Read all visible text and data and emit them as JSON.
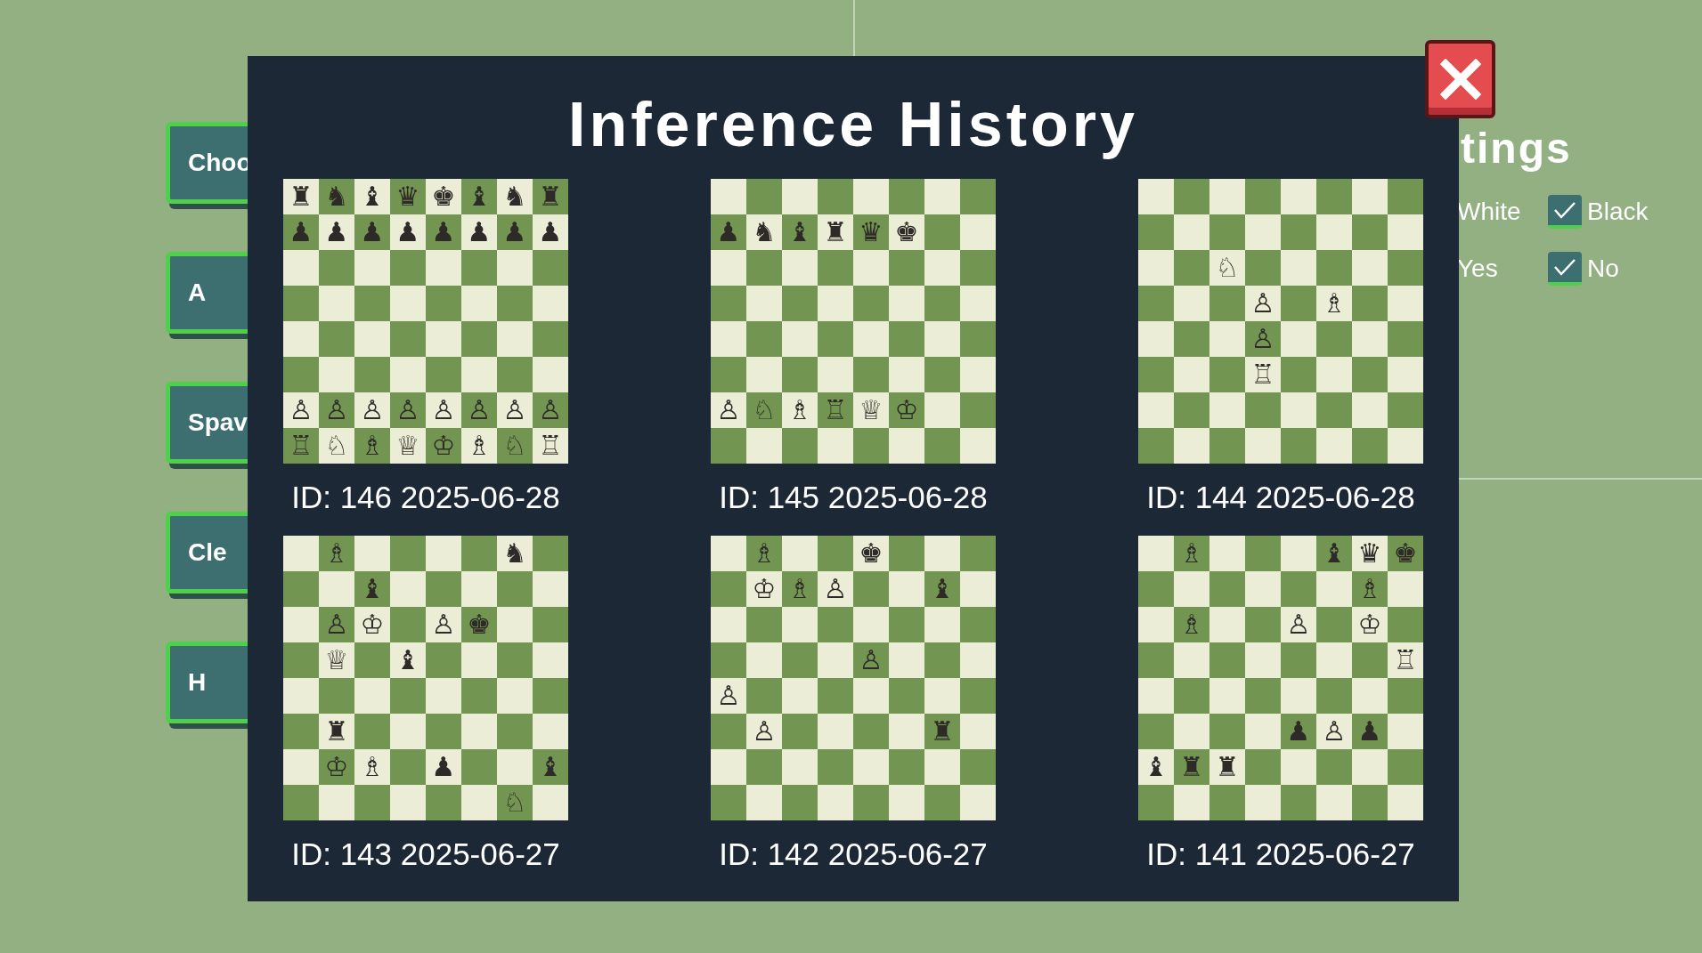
{
  "side_buttons": [
    {
      "label": "Choo"
    },
    {
      "label": "A"
    },
    {
      "label": "Spav"
    },
    {
      "label": "Cle"
    },
    {
      "label": "H"
    }
  ],
  "settings": {
    "title": "tings",
    "rows": [
      [
        {
          "label": "White"
        },
        {
          "label": "Black",
          "checked": true
        }
      ],
      [
        {
          "label": "Yes"
        },
        {
          "label": "No",
          "checked": true
        }
      ]
    ]
  },
  "dialog": {
    "title": "Inference History",
    "close": {
      "kind": "close"
    },
    "entries": [
      {
        "caption": "ID: 146 2025-06-28",
        "rows": [
          [
            {
              "kind": "piece",
              "glyph": "♜"
            },
            {
              "kind": "piece",
              "glyph": "♞"
            },
            {
              "kind": "piece",
              "glyph": "♝"
            },
            {
              "kind": "piece",
              "glyph": "♛"
            },
            {
              "kind": "piece",
              "glyph": "♚"
            },
            {
              "kind": "piece",
              "glyph": "♝"
            },
            {
              "kind": "piece",
              "glyph": "♞"
            },
            {
              "kind": "piece",
              "glyph": "♜"
            }
          ],
          [
            {
              "kind": "piece",
              "glyph": "♟"
            },
            {
              "kind": "piece",
              "glyph": "♟"
            },
            {
              "kind": "piece",
              "glyph": "♟"
            },
            {
              "kind": "piece",
              "glyph": "♟"
            },
            {
              "kind": "piece",
              "glyph": "♟"
            },
            {
              "kind": "piece",
              "glyph": "♟"
            },
            {
              "kind": "piece",
              "glyph": "♟"
            },
            {
              "kind": "piece",
              "glyph": "♟"
            }
          ],
          [
            {
              "kind": "empty"
            },
            {
              "kind": "empty"
            },
            {
              "kind": "empty"
            },
            {
              "kind": "empty"
            },
            {
              "kind": "empty"
            },
            {
              "kind": "empty"
            },
            {
              "kind": "empty"
            },
            {
              "kind": "empty"
            }
          ],
          [
            {
              "kind": "empty"
            },
            {
              "kind": "empty"
            },
            {
              "kind": "empty"
            },
            {
              "kind": "empty"
            },
            {
              "kind": "empty"
            },
            {
              "kind": "empty"
            },
            {
              "kind": "empty"
            },
            {
              "kind": "empty"
            }
          ],
          [
            {
              "kind": "empty"
            },
            {
              "kind": "empty"
            },
            {
              "kind": "empty"
            },
            {
              "kind": "empty"
            },
            {
              "kind": "empty"
            },
            {
              "kind": "empty"
            },
            {
              "kind": "empty"
            },
            {
              "kind": "empty"
            }
          ],
          [
            {
              "kind": "empty"
            },
            {
              "kind": "empty"
            },
            {
              "kind": "empty"
            },
            {
              "kind": "empty"
            },
            {
              "kind": "empty"
            },
            {
              "kind": "empty"
            },
            {
              "kind": "empty"
            },
            {
              "kind": "empty"
            }
          ],
          [
            {
              "kind": "piece",
              "glyph": "♙"
            },
            {
              "kind": "piece",
              "glyph": "♙"
            },
            {
              "kind": "piece",
              "glyph": "♙"
            },
            {
              "kind": "piece",
              "glyph": "♙"
            },
            {
              "kind": "piece",
              "glyph": "♙"
            },
            {
              "kind": "piece",
              "glyph": "♙"
            },
            {
              "kind": "piece",
              "glyph": "♙"
            },
            {
              "kind": "piece",
              "glyph": "♙"
            }
          ],
          [
            {
              "kind": "piece",
              "glyph": "♖"
            },
            {
              "kind": "piece",
              "glyph": "♘"
            },
            {
              "kind": "piece",
              "glyph": "♗"
            },
            {
              "kind": "piece",
              "glyph": "♕"
            },
            {
              "kind": "piece",
              "glyph": "♔"
            },
            {
              "kind": "piece",
              "glyph": "♗"
            },
            {
              "kind": "piece",
              "glyph": "♘"
            },
            {
              "kind": "piece",
              "glyph": "♖"
            }
          ]
        ]
      },
      {
        "caption": "ID: 145 2025-06-28",
        "rows": [
          [
            {
              "kind": "empty"
            },
            {
              "kind": "empty"
            },
            {
              "kind": "empty"
            },
            {
              "kind": "empty"
            },
            {
              "kind": "empty"
            },
            {
              "kind": "empty"
            },
            {
              "kind": "empty"
            },
            {
              "kind": "empty"
            }
          ],
          [
            {
              "kind": "piece",
              "glyph": "♟"
            },
            {
              "kind": "piece",
              "glyph": "♞"
            },
            {
              "kind": "piece",
              "glyph": "♝"
            },
            {
              "kind": "piece",
              "glyph": "♜"
            },
            {
              "kind": "piece",
              "glyph": "♛"
            },
            {
              "kind": "piece",
              "glyph": "♚"
            },
            {
              "kind": "empty"
            },
            {
              "kind": "empty"
            }
          ],
          [
            {
              "kind": "empty"
            },
            {
              "kind": "empty"
            },
            {
              "kind": "empty"
            },
            {
              "kind": "empty"
            },
            {
              "kind": "empty"
            },
            {
              "kind": "empty"
            },
            {
              "kind": "empty"
            },
            {
              "kind": "empty"
            }
          ],
          [
            {
              "kind": "empty"
            },
            {
              "kind": "empty"
            },
            {
              "kind": "empty"
            },
            {
              "kind": "empty"
            },
            {
              "kind": "empty"
            },
            {
              "kind": "empty"
            },
            {
              "kind": "empty"
            },
            {
              "kind": "empty"
            }
          ],
          [
            {
              "kind": "empty"
            },
            {
              "kind": "empty"
            },
            {
              "kind": "empty"
            },
            {
              "kind": "empty"
            },
            {
              "kind": "empty"
            },
            {
              "kind": "empty"
            },
            {
              "kind": "empty"
            },
            {
              "kind": "empty"
            }
          ],
          [
            {
              "kind": "empty"
            },
            {
              "kind": "empty"
            },
            {
              "kind": "empty"
            },
            {
              "kind": "empty"
            },
            {
              "kind": "empty"
            },
            {
              "kind": "empty"
            },
            {
              "kind": "empty"
            },
            {
              "kind": "empty"
            }
          ],
          [
            {
              "kind": "piece",
              "glyph": "♙"
            },
            {
              "kind": "piece",
              "glyph": "♘"
            },
            {
              "kind": "piece",
              "glyph": "♗"
            },
            {
              "kind": "piece",
              "glyph": "♖"
            },
            {
              "kind": "piece",
              "glyph": "♕"
            },
            {
              "kind": "piece",
              "glyph": "♔"
            },
            {
              "kind": "empty"
            },
            {
              "kind": "empty"
            }
          ],
          [
            {
              "kind": "empty"
            },
            {
              "kind": "empty"
            },
            {
              "kind": "empty"
            },
            {
              "kind": "empty"
            },
            {
              "kind": "empty"
            },
            {
              "kind": "empty"
            },
            {
              "kind": "empty"
            },
            {
              "kind": "empty"
            }
          ]
        ]
      },
      {
        "caption": "ID: 144 2025-06-28",
        "rows": [
          [
            {
              "kind": "empty"
            },
            {
              "kind": "empty"
            },
            {
              "kind": "empty"
            },
            {
              "kind": "empty"
            },
            {
              "kind": "empty"
            },
            {
              "kind": "empty"
            },
            {
              "kind": "empty"
            },
            {
              "kind": "empty"
            }
          ],
          [
            {
              "kind": "empty"
            },
            {
              "kind": "empty"
            },
            {
              "kind": "empty"
            },
            {
              "kind": "empty"
            },
            {
              "kind": "empty"
            },
            {
              "kind": "empty"
            },
            {
              "kind": "empty"
            },
            {
              "kind": "empty"
            }
          ],
          [
            {
              "kind": "empty"
            },
            {
              "kind": "empty"
            },
            {
              "kind": "piece",
              "glyph": "♘"
            },
            {
              "kind": "empty"
            },
            {
              "kind": "empty"
            },
            {
              "kind": "empty"
            },
            {
              "kind": "empty"
            },
            {
              "kind": "empty"
            }
          ],
          [
            {
              "kind": "empty"
            },
            {
              "kind": "empty"
            },
            {
              "kind": "empty"
            },
            {
              "kind": "piece",
              "glyph": "♙"
            },
            {
              "kind": "empty"
            },
            {
              "kind": "piece",
              "glyph": "♗"
            },
            {
              "kind": "empty"
            },
            {
              "kind": "empty"
            }
          ],
          [
            {
              "kind": "empty"
            },
            {
              "kind": "empty"
            },
            {
              "kind": "empty"
            },
            {
              "kind": "piece",
              "glyph": "♙"
            },
            {
              "kind": "empty"
            },
            {
              "kind": "empty"
            },
            {
              "kind": "empty"
            },
            {
              "kind": "empty"
            }
          ],
          [
            {
              "kind": "empty"
            },
            {
              "kind": "empty"
            },
            {
              "kind": "empty"
            },
            {
              "kind": "piece",
              "glyph": "♖"
            },
            {
              "kind": "empty"
            },
            {
              "kind": "empty"
            },
            {
              "kind": "empty"
            },
            {
              "kind": "empty"
            }
          ],
          [
            {
              "kind": "empty"
            },
            {
              "kind": "empty"
            },
            {
              "kind": "empty"
            },
            {
              "kind": "empty"
            },
            {
              "kind": "empty"
            },
            {
              "kind": "empty"
            },
            {
              "kind": "empty"
            },
            {
              "kind": "empty"
            }
          ],
          [
            {
              "kind": "empty"
            },
            {
              "kind": "empty"
            },
            {
              "kind": "empty"
            },
            {
              "kind": "empty"
            },
            {
              "kind": "empty"
            },
            {
              "kind": "empty"
            },
            {
              "kind": "empty"
            },
            {
              "kind": "empty"
            }
          ]
        ]
      },
      {
        "caption": "ID: 143 2025-06-27",
        "rows": [
          [
            {
              "kind": "empty"
            },
            {
              "kind": "piece",
              "glyph": "♗"
            },
            {
              "kind": "empty"
            },
            {
              "kind": "empty"
            },
            {
              "kind": "empty"
            },
            {
              "kind": "empty"
            },
            {
              "kind": "piece",
              "glyph": "♞"
            },
            {
              "kind": "empty"
            }
          ],
          [
            {
              "kind": "empty"
            },
            {
              "kind": "empty"
            },
            {
              "kind": "piece",
              "glyph": "♝"
            },
            {
              "kind": "empty"
            },
            {
              "kind": "empty"
            },
            {
              "kind": "empty"
            },
            {
              "kind": "empty"
            },
            {
              "kind": "empty"
            }
          ],
          [
            {
              "kind": "empty"
            },
            {
              "kind": "piece",
              "glyph": "♙"
            },
            {
              "kind": "piece",
              "glyph": "♔"
            },
            {
              "kind": "empty"
            },
            {
              "kind": "piece",
              "glyph": "♙"
            },
            {
              "kind": "piece",
              "glyph": "♚"
            },
            {
              "kind": "empty"
            },
            {
              "kind": "empty"
            }
          ],
          [
            {
              "kind": "empty"
            },
            {
              "kind": "piece",
              "glyph": "♕"
            },
            {
              "kind": "empty"
            },
            {
              "kind": "piece",
              "glyph": "♝"
            },
            {
              "kind": "empty"
            },
            {
              "kind": "empty"
            },
            {
              "kind": "empty"
            },
            {
              "kind": "empty"
            }
          ],
          [
            {
              "kind": "empty"
            },
            {
              "kind": "empty"
            },
            {
              "kind": "empty"
            },
            {
              "kind": "empty"
            },
            {
              "kind": "empty"
            },
            {
              "kind": "empty"
            },
            {
              "kind": "empty"
            },
            {
              "kind": "empty"
            }
          ],
          [
            {
              "kind": "empty"
            },
            {
              "kind": "piece",
              "glyph": "♜"
            },
            {
              "kind": "empty"
            },
            {
              "kind": "empty"
            },
            {
              "kind": "empty"
            },
            {
              "kind": "empty"
            },
            {
              "kind": "empty"
            },
            {
              "kind": "empty"
            }
          ],
          [
            {
              "kind": "empty"
            },
            {
              "kind": "piece",
              "glyph": "♔"
            },
            {
              "kind": "piece",
              "glyph": "♗"
            },
            {
              "kind": "empty"
            },
            {
              "kind": "piece",
              "glyph": "♟"
            },
            {
              "kind": "empty"
            },
            {
              "kind": "empty"
            },
            {
              "kind": "piece",
              "glyph": "♝"
            }
          ],
          [
            {
              "kind": "empty"
            },
            {
              "kind": "empty"
            },
            {
              "kind": "empty"
            },
            {
              "kind": "empty"
            },
            {
              "kind": "empty"
            },
            {
              "kind": "empty"
            },
            {
              "kind": "piece",
              "glyph": "♘"
            },
            {
              "kind": "empty"
            }
          ]
        ]
      },
      {
        "caption": "ID: 142 2025-06-27",
        "rows": [
          [
            {
              "kind": "empty"
            },
            {
              "kind": "piece",
              "glyph": "♗"
            },
            {
              "kind": "empty"
            },
            {
              "kind": "empty"
            },
            {
              "kind": "piece",
              "glyph": "♚"
            },
            {
              "kind": "empty"
            },
            {
              "kind": "empty"
            },
            {
              "kind": "empty"
            }
          ],
          [
            {
              "kind": "empty"
            },
            {
              "kind": "piece",
              "glyph": "♔"
            },
            {
              "kind": "piece",
              "glyph": "♗"
            },
            {
              "kind": "piece",
              "glyph": "♙"
            },
            {
              "kind": "empty"
            },
            {
              "kind": "empty"
            },
            {
              "kind": "piece",
              "glyph": "♝"
            },
            {
              "kind": "empty"
            }
          ],
          [
            {
              "kind": "empty"
            },
            {
              "kind": "empty"
            },
            {
              "kind": "empty"
            },
            {
              "kind": "empty"
            },
            {
              "kind": "empty"
            },
            {
              "kind": "empty"
            },
            {
              "kind": "empty"
            },
            {
              "kind": "empty"
            }
          ],
          [
            {
              "kind": "empty"
            },
            {
              "kind": "empty"
            },
            {
              "kind": "empty"
            },
            {
              "kind": "empty"
            },
            {
              "kind": "piece",
              "glyph": "♙"
            },
            {
              "kind": "empty"
            },
            {
              "kind": "empty"
            },
            {
              "kind": "empty"
            }
          ],
          [
            {
              "kind": "piece",
              "glyph": "♙"
            },
            {
              "kind": "empty"
            },
            {
              "kind": "empty"
            },
            {
              "kind": "empty"
            },
            {
              "kind": "empty"
            },
            {
              "kind": "empty"
            },
            {
              "kind": "empty"
            },
            {
              "kind": "empty"
            }
          ],
          [
            {
              "kind": "empty"
            },
            {
              "kind": "piece",
              "glyph": "♙"
            },
            {
              "kind": "empty"
            },
            {
              "kind": "empty"
            },
            {
              "kind": "empty"
            },
            {
              "kind": "empty"
            },
            {
              "kind": "piece",
              "glyph": "♜"
            },
            {
              "kind": "empty"
            }
          ],
          [
            {
              "kind": "empty"
            },
            {
              "kind": "empty"
            },
            {
              "kind": "empty"
            },
            {
              "kind": "empty"
            },
            {
              "kind": "empty"
            },
            {
              "kind": "empty"
            },
            {
              "kind": "empty"
            },
            {
              "kind": "empty"
            }
          ],
          [
            {
              "kind": "empty"
            },
            {
              "kind": "empty"
            },
            {
              "kind": "empty"
            },
            {
              "kind": "empty"
            },
            {
              "kind": "empty"
            },
            {
              "kind": "empty"
            },
            {
              "kind": "empty"
            },
            {
              "kind": "empty"
            }
          ]
        ]
      },
      {
        "caption": "ID: 141 2025-06-27",
        "rows": [
          [
            {
              "kind": "empty"
            },
            {
              "kind": "piece",
              "glyph": "♗"
            },
            {
              "kind": "empty"
            },
            {
              "kind": "empty"
            },
            {
              "kind": "empty"
            },
            {
              "kind": "piece",
              "glyph": "♝"
            },
            {
              "kind": "piece",
              "glyph": "♛"
            },
            {
              "kind": "piece",
              "glyph": "♚"
            }
          ],
          [
            {
              "kind": "empty"
            },
            {
              "kind": "empty"
            },
            {
              "kind": "empty"
            },
            {
              "kind": "empty"
            },
            {
              "kind": "empty"
            },
            {
              "kind": "empty"
            },
            {
              "kind": "piece",
              "glyph": "♗"
            },
            {
              "kind": "empty"
            }
          ],
          [
            {
              "kind": "empty"
            },
            {
              "kind": "piece",
              "glyph": "♗"
            },
            {
              "kind": "empty"
            },
            {
              "kind": "empty"
            },
            {
              "kind": "piece",
              "glyph": "♙"
            },
            {
              "kind": "empty"
            },
            {
              "kind": "piece",
              "glyph": "♔"
            },
            {
              "kind": "empty"
            }
          ],
          [
            {
              "kind": "empty"
            },
            {
              "kind": "empty"
            },
            {
              "kind": "empty"
            },
            {
              "kind": "empty"
            },
            {
              "kind": "empty"
            },
            {
              "kind": "empty"
            },
            {
              "kind": "empty"
            },
            {
              "kind": "piece",
              "glyph": "♖"
            }
          ],
          [
            {
              "kind": "empty"
            },
            {
              "kind": "empty"
            },
            {
              "kind": "empty"
            },
            {
              "kind": "empty"
            },
            {
              "kind": "empty"
            },
            {
              "kind": "empty"
            },
            {
              "kind": "empty"
            },
            {
              "kind": "empty"
            }
          ],
          [
            {
              "kind": "empty"
            },
            {
              "kind": "empty"
            },
            {
              "kind": "empty"
            },
            {
              "kind": "empty"
            },
            {
              "kind": "piece",
              "glyph": "♟"
            },
            {
              "kind": "piece",
              "glyph": "♙"
            },
            {
              "kind": "piece",
              "glyph": "♟"
            },
            {
              "kind": "empty"
            }
          ],
          [
            {
              "kind": "piece",
              "glyph": "♝"
            },
            {
              "kind": "piece",
              "glyph": "♜"
            },
            {
              "kind": "piece",
              "glyph": "♜"
            },
            {
              "kind": "empty"
            },
            {
              "kind": "empty"
            },
            {
              "kind": "empty"
            },
            {
              "kind": "empty"
            },
            {
              "kind": "empty"
            }
          ],
          [
            {
              "kind": "empty"
            },
            {
              "kind": "empty"
            },
            {
              "kind": "empty"
            },
            {
              "kind": "empty"
            },
            {
              "kind": "empty"
            },
            {
              "kind": "empty"
            },
            {
              "kind": "empty"
            },
            {
              "kind": "empty"
            }
          ]
        ]
      }
    ]
  }
}
